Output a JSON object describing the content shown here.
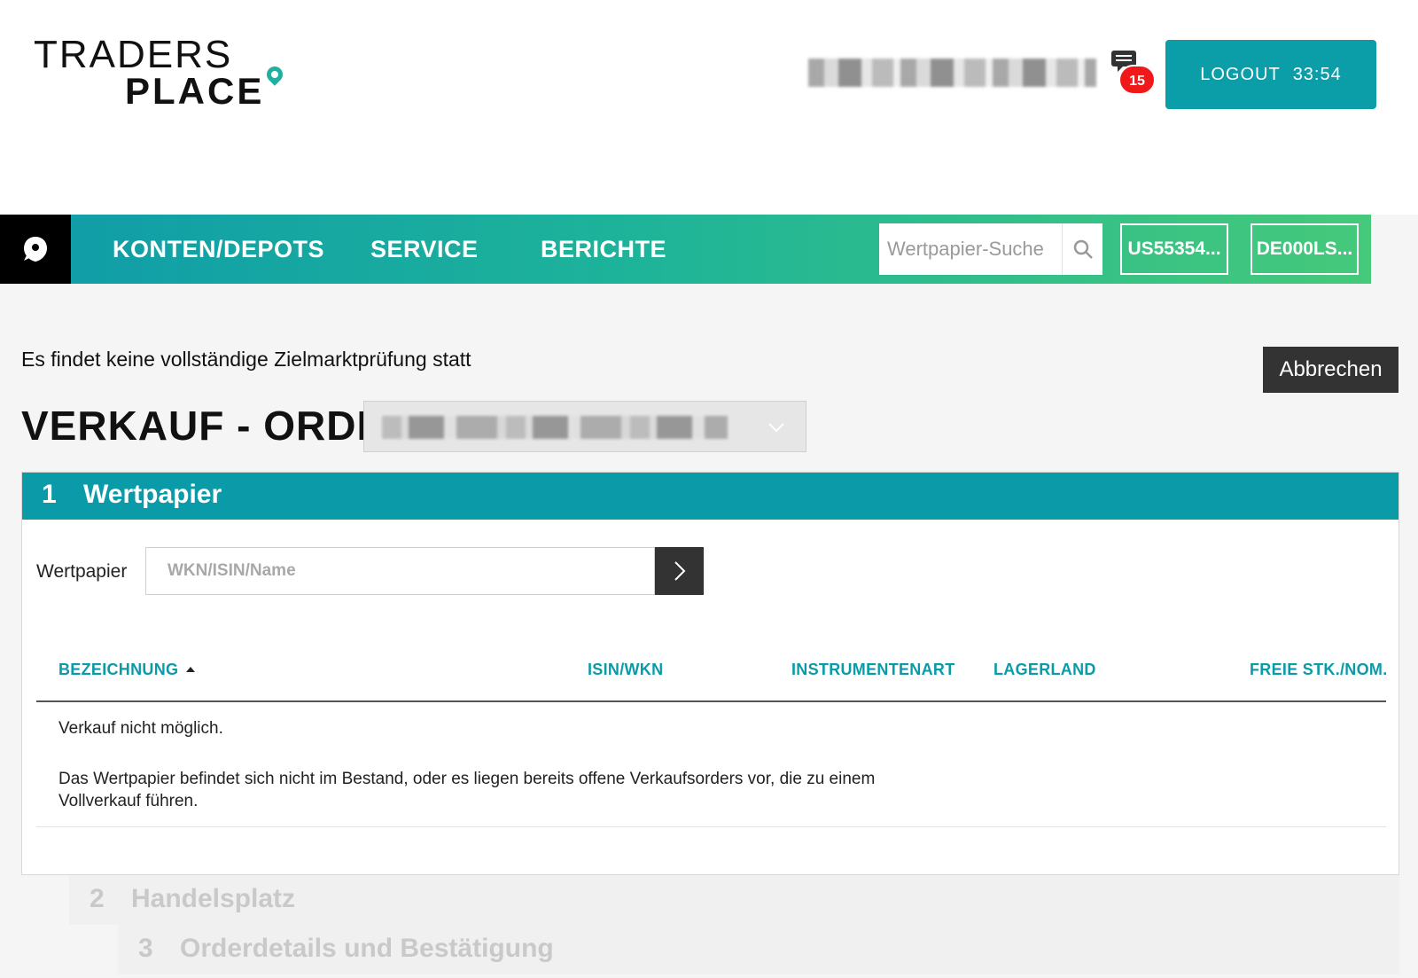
{
  "header": {
    "logo_line1": "TRADERS",
    "logo_line2": "PLACE",
    "message_count": "15",
    "logout_label": "LOGOUT",
    "session_timer": "33:54"
  },
  "nav": {
    "items": [
      {
        "label": "KONTEN/DEPOTS"
      },
      {
        "label": "SERVICE"
      },
      {
        "label": "BERICHTE"
      }
    ],
    "search_placeholder": "Wertpapier-Suche",
    "recent": [
      {
        "label": "US55354..."
      },
      {
        "label": "DE000LS..."
      }
    ]
  },
  "main": {
    "notice": "Es findet keine vollständige Zielmarktprüfung statt",
    "cancel_label": "Abbrechen",
    "title": "VERKAUF - ORDER"
  },
  "section1": {
    "number": "1",
    "title": "Wertpapier",
    "field_label": "Wertpapier",
    "input_placeholder": "WKN/ISIN/Name",
    "columns": [
      "BEZEICHNUNG",
      "ISIN/WKN",
      "INSTRUMENTENART",
      "LAGERLAND",
      "FREIE STK./NOM."
    ],
    "empty_title": "Verkauf nicht möglich.",
    "empty_desc": "Das Wertpapier befindet sich nicht im Bestand, oder es liegen bereits offene Verkaufsorders vor, die zu einem Vollverkauf führen."
  },
  "steps": [
    {
      "number": "2",
      "title": "Handelsplatz"
    },
    {
      "number": "3",
      "title": "Orderdetails und Bestätigung"
    }
  ],
  "colors": {
    "accent": "#0a9aa8",
    "badge": "#f01818",
    "dark_button": "#333333"
  }
}
